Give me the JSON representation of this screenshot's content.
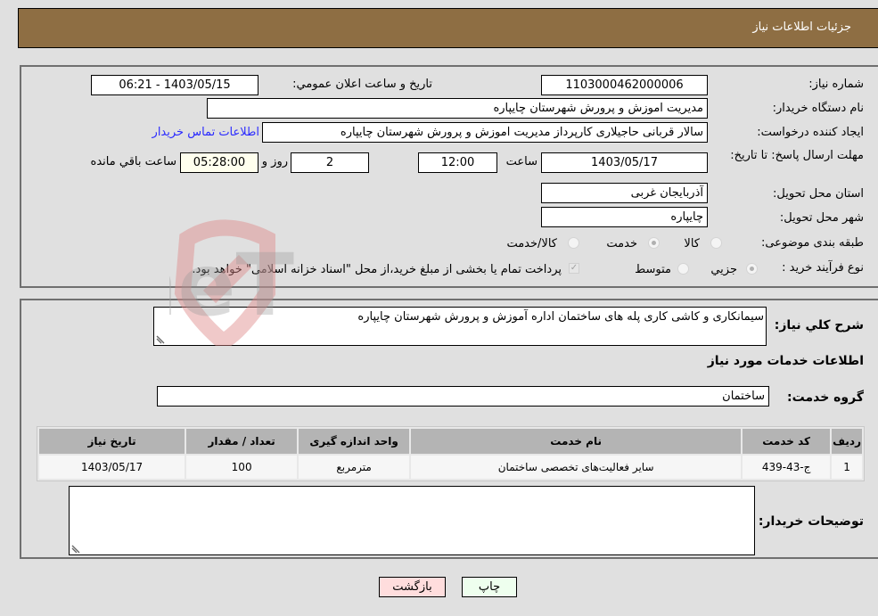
{
  "header": {
    "title": "جزئیات اطلاعات نیاز"
  },
  "details": {
    "need_number_label": "شماره نیاز:",
    "need_number": "1103000462000006",
    "announce_label": "تاریخ و ساعت اعلان عمومي:",
    "announce_value": "1403/05/15 - 06:21",
    "buyer_org_label": "نام دستگاه خریدار:",
    "buyer_org": "مدیریت اموزش و پرورش شهرستان چایپاره",
    "creator_label": "ایجاد کننده درخواست:",
    "creator": "سالار قربانی حاجیلاری کارپرداز مدیریت اموزش و پرورش شهرستان چایپاره",
    "contact_link": "اطلاعات تماس خریدار",
    "deadline_label": "مهلت ارسال پاسخ: تا تاریخ:",
    "deadline_date": "1403/05/17",
    "time_label": "ساعت",
    "deadline_time": "12:00",
    "days": "2",
    "days_label": "روز و",
    "remaining": "05:28:00",
    "remaining_label": "ساعت باقي مانده",
    "province_label": "استان محل تحویل:",
    "province": "آذربایجان غربی",
    "city_label": "شهر محل تحویل:",
    "city": "چایپاره",
    "category_label": "طبقه بندی موضوعی:",
    "category_options": [
      "کالا",
      "خدمت",
      "کالا/خدمت"
    ],
    "category_selected": "خدمت",
    "process_label": "نوع فرآیند خرید :",
    "process_options": [
      "جزيي",
      "متوسط"
    ],
    "process_selected": "جزيي",
    "payment_note": "پرداخت تمام یا بخشی از مبلغ خرید،از محل \"اسناد خزانه اسلامی\" خواهد بود."
  },
  "description": {
    "label": "شرح کلي نياز:",
    "value": "سیمانکاری و کاشی کاری پله های ساختمان اداره آموزش و پرورش شهرستان چایپاره"
  },
  "services": {
    "section_title": "اطلاعات خدمات مورد نياز",
    "group_label": "گروه خدمت:",
    "group_value": "ساختمان",
    "columns": [
      "ردیف",
      "کد خدمت",
      "نام خدمت",
      "واحد اندازه گیری",
      "تعداد / مقدار",
      "تاریخ نیاز"
    ],
    "rows": [
      [
        "1",
        "ج-43-439",
        "سایر فعالیت‌های تخصصی ساختمان",
        "مترمربع",
        "100",
        "1403/05/17"
      ]
    ]
  },
  "buyer_notes": {
    "label": "توضیحات خریدار:",
    "value": ""
  },
  "buttons": {
    "print": "چاپ",
    "back": "بازگشت"
  },
  "watermark": {
    "text": "AriaTender.neT"
  },
  "colors": {
    "header": "#8e6e43",
    "print_bg": "#eeffee",
    "back_bg": "#ffdddd",
    "link": "#2a2aff"
  }
}
